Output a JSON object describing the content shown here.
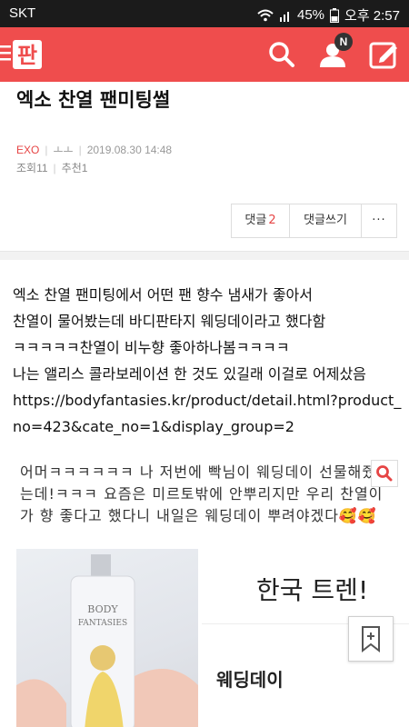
{
  "status_bar": {
    "carrier": "SKT",
    "battery": "45%",
    "time": "오후 2:57"
  },
  "header": {
    "notification_badge": "N"
  },
  "post": {
    "title": "엑소 찬열 팬미팅썰",
    "category": "EXO",
    "author": "ㅗㅗ",
    "date": "2019.08.30 14:48",
    "views": "조회11",
    "recommends": "추천1",
    "comment_label": "댓글",
    "comment_count": "2",
    "write_comment_label": "댓글쓰기",
    "more_label": "···",
    "lines": [
      "엑소 찬열 팬미팅에서 어떤 팬 향수 냄새가 좋아서",
      "찬열이 물어봤는데 바디판타지 웨딩데이라고 했다함",
      "ㅋㅋㅋㅋㅋ찬열이 비누향 좋아하나봄ㅋㅋㅋㅋ",
      "나는 앨리스 콜라보레이션 한 것도 있길래 이걸로 어제샀음",
      "https://bodyfantasies.kr/product/detail.html?product_",
      "no=423&cate_no=1&display_group=2"
    ]
  },
  "image": {
    "caption": "어머ㅋㅋㅋㅋㅋㅋ 나 저번에 빡님이 웨딩데이 선물해줬는데!ㅋㅋㅋ 요즘은 미르토밖에 안뿌리지만 우리 찬열이가 향 좋다고 했다니 내일은 웨딩데이 뿌려야겠다🥰🥰",
    "screenshot_title": "한국 트렌!",
    "screenshot_subtitle": "웨딩데이"
  },
  "colors": {
    "brand": "#ef4d4d",
    "accent": "#e64545"
  },
  "icons": [
    "menu-icon",
    "logo-icon",
    "search-icon",
    "user-icon",
    "write-icon",
    "magnifier-icon",
    "bookmark-add-icon"
  ]
}
